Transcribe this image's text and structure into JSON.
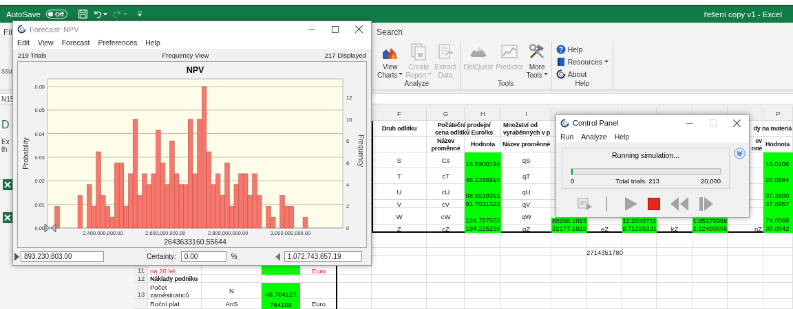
{
  "excel": {
    "autosave": {
      "label": "AutoSave",
      "on": false,
      "state_text": "Off"
    },
    "redo_disabled": true,
    "title": "řešení copy v1 - Excel",
    "file_tab": "Fil",
    "search_label": "Search",
    "name_box": "N15",
    "ribbon": {
      "left_fragment": "ssu",
      "groups": [
        {
          "label": "Analyze",
          "kind": "large",
          "items": [
            {
              "lines": [
                "View",
                "Charts"
              ],
              "dropdown": true,
              "disabled": false
            },
            {
              "lines": [
                "Create",
                "Report"
              ],
              "dropdown": true,
              "disabled": true
            },
            {
              "lines": [
                "Extract",
                "Data"
              ],
              "dropdown": false,
              "disabled": true
            }
          ]
        },
        {
          "label": "Tools",
          "kind": "large",
          "items": [
            {
              "lines": [
                "OptQuest"
              ],
              "dropdown": false,
              "disabled": true
            },
            {
              "lines": [
                "Predictor"
              ],
              "dropdown": false,
              "disabled": true
            },
            {
              "lines": [
                "More",
                "Tools"
              ],
              "dropdown": true,
              "disabled": false
            }
          ]
        },
        {
          "label": "Help",
          "kind": "small",
          "items": [
            {
              "lines": [
                "Help"
              ],
              "dropdown": false,
              "disabled": false
            },
            {
              "lines": [
                "Resources"
              ],
              "dropdown": true,
              "disabled": false
            },
            {
              "lines": [
                "About"
              ],
              "dropdown": false,
              "disabled": false
            }
          ]
        }
      ]
    },
    "side_pane": {
      "title": "D",
      "lines": [
        "Ex",
        "th"
      ]
    }
  },
  "forecast": {
    "title": "Forecast: NPV",
    "active": false,
    "menu": [
      "Edit",
      "View",
      "Forecast",
      "Preferences",
      "Help"
    ],
    "trials": "219 Trials",
    "view": "Frequency View",
    "displayed": "217 Displayed",
    "chart_data": {
      "type": "bar",
      "title": "NPV",
      "xlabel": "2643633160.55644",
      "ylabel": "Probability",
      "y2label": "Frequency",
      "x": [
        2253700000,
        2327175000,
        2356565000,
        2371260000,
        2385955000,
        2400650000,
        2415345000,
        2430040000,
        2444735000,
        2459430000,
        2474125000,
        2488820000,
        2503515000,
        2518210000,
        2532905000,
        2547600000,
        2562295000,
        2576990000,
        2591685000,
        2606380000,
        2621075000,
        2635770000,
        2650465000,
        2665160000,
        2679855000,
        2694550000,
        2709245000,
        2723940000,
        2738635000,
        2753330000,
        2768025000,
        2782720000,
        2797415000,
        2812110000,
        2826805000,
        2841500000,
        2856195000,
        2870890000,
        2885585000,
        2900280000,
        2929670000,
        2944365000,
        2973755000,
        2988450000,
        3003145000,
        3047230000
      ],
      "values": [
        0.0092,
        0.0138,
        0.0184,
        0.0092,
        0.0323,
        0.0138,
        0.0092,
        0.0046,
        0.0276,
        0.0276,
        0.0092,
        0.023,
        0.0461,
        0.0138,
        0.023,
        0.0184,
        0.023,
        0.0415,
        0.0276,
        0.0184,
        0.0369,
        0.023,
        0.0184,
        0.0184,
        0.0461,
        0.023,
        0.0461,
        0.0599,
        0.0323,
        0.0184,
        0.023,
        0.0138,
        0.0276,
        0.0092,
        0.0184,
        0.023,
        0.023,
        0.0138,
        0.023,
        0.0138,
        0.0092,
        0.0046,
        0.0138,
        0.0092,
        0.0092,
        0.0046
      ],
      "xlim": [
        2222790000,
        3167390000
      ],
      "ylim": [
        0,
        0.06313
      ],
      "y2lim": [
        0,
        13.7
      ],
      "xticks": [
        {
          "value": 2400000000,
          "label": "2,400,000,000.00"
        },
        {
          "value": 2600000000,
          "label": "2,600,000,000.00"
        },
        {
          "value": 2800000000,
          "label": "2,800,000,000.00"
        },
        {
          "value": 3000000000,
          "label": "3,000,000,000.00"
        }
      ],
      "yticks": [
        {
          "value": 0,
          "label": "0.00"
        },
        {
          "value": 0.01,
          "label": "0.01"
        },
        {
          "value": 0.02,
          "label": "0.02"
        },
        {
          "value": 0.03,
          "label": "0.03"
        },
        {
          "value": 0.04,
          "label": "0.04"
        },
        {
          "value": 0.05,
          "label": "0.05"
        },
        {
          "value": 0.06,
          "label": "0.06"
        }
      ],
      "y2ticks": [
        0,
        2,
        4,
        6,
        8,
        10,
        12
      ],
      "grid": true
    },
    "left_value": "893,230,803.00",
    "certainty_label": "Certainty:",
    "certainty": "0.00",
    "percent": "%",
    "right_value": "1,072,743,657.19"
  },
  "control_panel": {
    "title": "Control Panel",
    "active": true,
    "maximize_disabled": true,
    "menu": [
      "Run",
      "Analyze",
      "Help"
    ],
    "status": "Running simulation...",
    "progress": {
      "level": 0.01065,
      "min": "0",
      "total": "Total trials: 213",
      "max": "20,000"
    },
    "expanded": false,
    "toolbar": [
      {
        "disabled": true
      },
      {
        "disabled": true
      },
      {
        "disabled": false
      },
      {
        "disabled": true
      },
      {
        "disabled": true
      }
    ]
  },
  "sheet": {
    "columns": [
      "F",
      "G",
      "H",
      "I",
      "P"
    ],
    "rows": [
      {
        "F": {
          "kind": "header",
          "text": "Druh odlitku"
        },
        "G": {
          "kind": "header",
          "merged": true,
          "text": "Počáteční prodejní\ncena odlitků Euro/ks"
        },
        "I": {
          "kind": "header",
          "merged": true,
          "text": "Množství od\nvyraběnných v p"
        },
        "O": {
          "kind": "header",
          "merged": true,
          "text": "dy na materiá"
        }
      },
      {
        "G": {
          "kind": "header",
          "text": "Název\nproměnné"
        },
        "H": {
          "kind": "header",
          "text": "Hodnota"
        },
        "I": {
          "kind": "header",
          "text": "Název proměnné"
        },
        "O": {
          "kind": "header",
          "text": "ev\nnné"
        },
        "P": {
          "kind": "header",
          "text": "Hodnota"
        }
      },
      {
        "F": {
          "kind": "label",
          "text": "S"
        },
        "G": {
          "kind": "label",
          "text": "Cs"
        },
        "H": {
          "kind": "value",
          "text": "18.5900194"
        },
        "I": {
          "kind": "label",
          "text": "qS"
        },
        "P": {
          "kind": "value",
          "text": "10.0106"
        }
      },
      {
        "F": {
          "kind": "label",
          "text": "T"
        },
        "G": {
          "kind": "label",
          "text": "cT"
        },
        "H": {
          "kind": "value",
          "text": "48.2286919"
        },
        "I": {
          "kind": "label",
          "text": "qT"
        },
        "P": {
          "kind": "value",
          "text": "20.0884"
        }
      },
      {
        "F": {
          "kind": "label",
          "text": "U"
        },
        "G": {
          "kind": "label",
          "text": "cU"
        },
        "H": {
          "kind": "value",
          "text": "98.6539361"
        },
        "I": {
          "kind": "label",
          "text": "qU"
        },
        "P": {
          "kind": "value",
          "text": "37.3800"
        }
      },
      {
        "F": {
          "kind": "label",
          "text": "V"
        },
        "G": {
          "kind": "label",
          "text": "cV"
        },
        "H": {
          "kind": "value",
          "text": "91.7031322"
        },
        "I": {
          "kind": "label",
          "text": "qV"
        },
        "P": {
          "kind": "value",
          "text": "37.0957"
        }
      },
      {
        "F": {
          "kind": "label",
          "text": "W"
        },
        "G": {
          "kind": "label",
          "text": "cW"
        },
        "H": {
          "kind": "value",
          "text": "124.797503"
        },
        "I": {
          "kind": "label",
          "text": "qW"
        },
        "J": {
          "kind": "value",
          "text": "80288.1023"
        },
        "L": {
          "kind": "value",
          "text": "11.2048711"
        },
        "N": {
          "kind": "value",
          "text": "1.95175966"
        },
        "P": {
          "kind": "value",
          "text": "74.0568"
        }
      },
      {
        "F": {
          "kind": "label",
          "text": "Z"
        },
        "G": {
          "kind": "label",
          "text": "cZ"
        },
        "H": {
          "kind": "value",
          "text": "194.225235"
        },
        "I": {
          "kind": "label",
          "text": "qZ"
        },
        "J": {
          "kind": "value",
          "text": "32177.1822"
        },
        "K": {
          "kind": "label",
          "text": "eZ"
        },
        "L": {
          "kind": "value",
          "text": "9.71265331"
        },
        "M": {
          "kind": "label",
          "text": "kZ"
        },
        "N": {
          "kind": "value",
          "text": "2.12493555"
        },
        "O": {
          "kind": "label",
          "text": "nZ"
        },
        "P": {
          "kind": "value",
          "text": "30.0842"
        }
      },
      {},
      {
        "K": {
          "kind": "label",
          "text": "2714351780"
        }
      },
      {
        "row_number": "11",
        "A": {
          "kind": "warning",
          "text": "na 20 let"
        },
        "C": {
          "kind": "value"
        },
        "D": {
          "kind": "warning",
          "text": "Euro"
        }
      },
      {
        "row_number": "12",
        "A": {
          "kind": "header",
          "text": "Náklady podniku"
        }
      },
      {
        "row_number": "13",
        "A": {
          "kind": "label",
          "text": "Počet\nzaměstnanců"
        },
        "B": {
          "kind": "label",
          "text": "N"
        },
        "C": {
          "kind": "value",
          "text": "48.704127"
        }
      },
      {
        "A": {
          "kind": "label",
          "text": "Roční plat"
        },
        "B": {
          "kind": "label",
          "text": "AnS"
        },
        "C": {
          "kind": "value",
          "text": "764199"
        },
        "D": {
          "kind": "label",
          "text": "Euro"
        }
      }
    ]
  }
}
